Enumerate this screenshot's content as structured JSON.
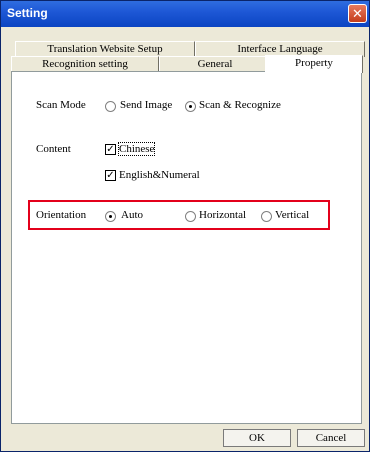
{
  "window": {
    "title": "Setting",
    "close_glyph": "✕"
  },
  "tabs": {
    "row1": [
      "Translation Website Setup",
      "Interface Language"
    ],
    "row2": [
      "Recognition setting",
      "General",
      "Property"
    ],
    "active": "Property"
  },
  "scan_mode": {
    "label": "Scan Mode",
    "options": [
      "Send Image",
      "Scan & Recognize"
    ],
    "selected": "Scan & Recognize"
  },
  "content": {
    "label": "Content",
    "options": [
      "Chinese",
      "English&Numeral"
    ],
    "checked": [
      "Chinese",
      "English&Numeral"
    ]
  },
  "orientation": {
    "label": "Orientation",
    "options": [
      "Auto",
      "Horizontal",
      "Vertical"
    ],
    "selected": "Auto",
    "highlight_color": "#e3001b"
  },
  "buttons": {
    "ok": "OK",
    "cancel": "Cancel"
  },
  "check_glyph": "✓"
}
